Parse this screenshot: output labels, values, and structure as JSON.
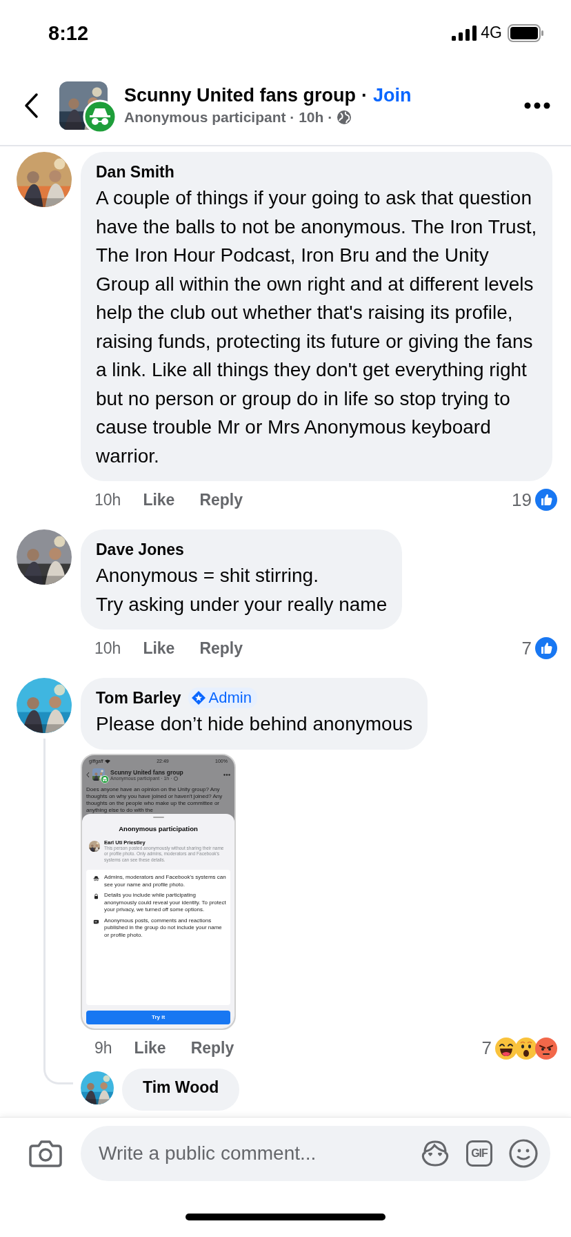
{
  "status_bar": {
    "time": "8:12",
    "network": "4G"
  },
  "header": {
    "group": "Scunny United fans group",
    "separator": "·",
    "join": "Join",
    "subtitle": "Anonymous participant · 10h ·"
  },
  "comments": [
    {
      "author": "Dan Smith",
      "text": "A couple of things if your going to ask that question have the balls to not be anonymous. The Iron Trust, The Iron Hour Podcast, Iron Bru and the Unity Group all within the own right and at different levels help the club out whether that's raising its profile, raising funds, protecting its future or giving the fans a link. Like all things they don't get everything right but no person or group do in life so stop trying to cause trouble Mr or Mrs Anonymous keyboard warrior.",
      "time": "10h",
      "like": "Like",
      "reply": "Reply",
      "count": "19",
      "reactions": [
        {
          "kind": "like"
        }
      ]
    },
    {
      "author": "Dave Jones",
      "text": "Anonymous = shit stirring.\nTry asking under your really name",
      "time": "10h",
      "like": "Like",
      "reply": "Reply",
      "count": "7",
      "reactions": [
        {
          "kind": "like"
        }
      ]
    },
    {
      "author": "Tom Barley",
      "badge": "Admin",
      "text": "Please don’t hide behind anonymous",
      "time": "9h",
      "like": "Like",
      "reply": "Reply",
      "count": "7",
      "reactions": [
        {
          "kind": "haha"
        },
        {
          "kind": "wow"
        },
        {
          "kind": "angry"
        }
      ],
      "attachment": {
        "carrier": "giffgaff",
        "time": "22:49",
        "battery": "100%",
        "group": "Scunny United fans group",
        "subtitle": "Anonymous participant · 1h ·",
        "post": "Does anyone have an opinion on the Unity group? Any thoughts on why you have joined or haven't joined? Any thoughts on the people who make up the committee or anything else to do with the",
        "sheet_title": "Anonymous participation",
        "person": "Earl Uti Priestley",
        "person_note": "This person posted anonymously without sharing their name or profile photo. Only admins, moderators and Facebook's systems can see these details.",
        "items": [
          {
            "kind": "incognito",
            "text": "Admins, moderators and Facebook's systems can see your name and profile photo."
          },
          {
            "kind": "lock",
            "text": "Details you include while participating anonymously could reveal your identity. To protect your privacy, we turned off some options."
          },
          {
            "kind": "card",
            "text": "Anonymous posts, comments and reactions published in the group do not include your name or profile photo."
          }
        ],
        "button": "Try it"
      },
      "replies": [
        {
          "author": "Tim Wood"
        }
      ]
    }
  ],
  "composer": {
    "placeholder": "Write a public comment...",
    "gif_label": "GIF"
  }
}
